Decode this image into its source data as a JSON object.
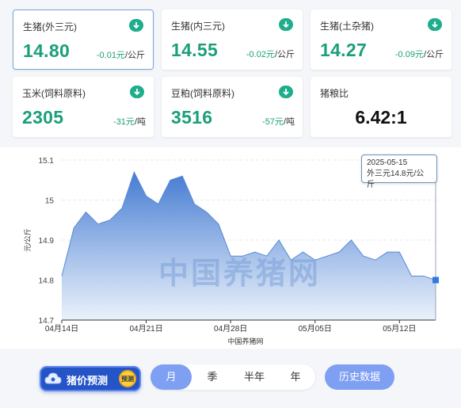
{
  "cards": [
    {
      "name": "生猪(外三元)",
      "price": "14.80",
      "change": "-0.01元",
      "unit": "/公斤",
      "icon": "down-arrow-icon"
    },
    {
      "name": "生猪(内三元)",
      "price": "14.55",
      "change": "-0.02元",
      "unit": "/公斤",
      "icon": "down-arrow-icon"
    },
    {
      "name": "生猪(土杂猪)",
      "price": "14.27",
      "change": "-0.09元",
      "unit": "/公斤",
      "icon": "down-arrow-icon"
    },
    {
      "name": "玉米(饲料原料)",
      "price": "2305",
      "change": "-31元",
      "unit": "/吨",
      "icon": "down-arrow-icon"
    },
    {
      "name": "豆粕(饲料原料)",
      "price": "3516",
      "change": "-57元",
      "unit": "/吨",
      "icon": "down-arrow-icon"
    },
    {
      "name": "猪粮比",
      "ratio": "6.42:1"
    }
  ],
  "colors": {
    "up_down_green": "#1a9f7a",
    "line_blue": "#4a7fcf",
    "accent": "#7e9ff2"
  },
  "chart_data": {
    "type": "area",
    "xlabel": "中国养猪网",
    "ylabel": "元/公斤",
    "ylim": [
      14.7,
      15.1
    ],
    "yticks": [
      "14.7",
      "14.8",
      "14.9",
      "15",
      "15.1"
    ],
    "xtick_labels": [
      "04月14日",
      "04月21日",
      "04月28日",
      "05月05日",
      "05月12日"
    ],
    "x": [
      "04-14",
      "04-15",
      "04-16",
      "04-17",
      "04-18",
      "04-19",
      "04-20",
      "04-21",
      "04-22",
      "04-23",
      "04-24",
      "04-25",
      "04-26",
      "04-27",
      "04-28",
      "04-29",
      "04-30",
      "05-01",
      "05-02",
      "05-03",
      "05-04",
      "05-05",
      "05-06",
      "05-07",
      "05-08",
      "05-09",
      "05-10",
      "05-11",
      "05-12",
      "05-13",
      "05-14",
      "05-15"
    ],
    "values": [
      14.81,
      14.93,
      14.97,
      14.94,
      14.95,
      14.98,
      15.07,
      15.01,
      14.99,
      15.05,
      15.06,
      14.99,
      14.97,
      14.94,
      14.86,
      14.86,
      14.87,
      14.86,
      14.9,
      14.85,
      14.87,
      14.85,
      14.86,
      14.87,
      14.9,
      14.86,
      14.85,
      14.87,
      14.87,
      14.81,
      14.81,
      14.8
    ],
    "grid": true,
    "tooltip": {
      "date": "2025-05-15",
      "text": "外三元14.8元/公斤"
    },
    "watermark": "中国养猪网"
  },
  "bottom": {
    "predict_label": "猪价预测",
    "predict_badge": "预测",
    "periods": [
      "月",
      "季",
      "半年",
      "年"
    ],
    "active_period": "月",
    "history_label": "历史数据"
  }
}
